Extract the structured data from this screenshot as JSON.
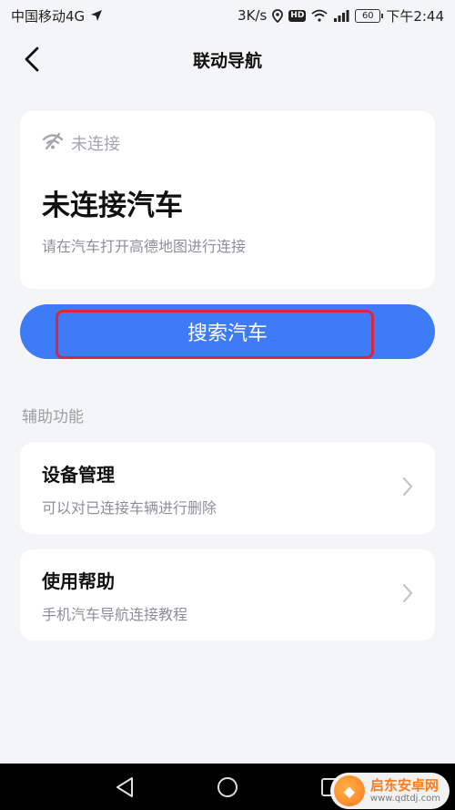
{
  "status_bar": {
    "carrier": "中国移动4G",
    "speed": "3K/s",
    "hd": "HD",
    "battery": "60",
    "time": "下午2:44"
  },
  "header": {
    "title": "联动导航"
  },
  "connection_card": {
    "status_label": "未连接",
    "title": "未连接汽车",
    "description": "请在汽车打开高德地图进行连接"
  },
  "search_button": {
    "label": "搜索汽车"
  },
  "aux_section": {
    "title": "辅助功能",
    "items": [
      {
        "title": "设备管理",
        "description": "可以对已连接车辆进行删除"
      },
      {
        "title": "使用帮助",
        "description": "手机汽车导航连接教程"
      }
    ]
  },
  "watermark": {
    "name": "启东安卓网",
    "url": "www.qdtdj.com"
  },
  "colors": {
    "accent": "#3e7bf7",
    "highlight": "#d7263d",
    "background": "#f4f5f7"
  }
}
